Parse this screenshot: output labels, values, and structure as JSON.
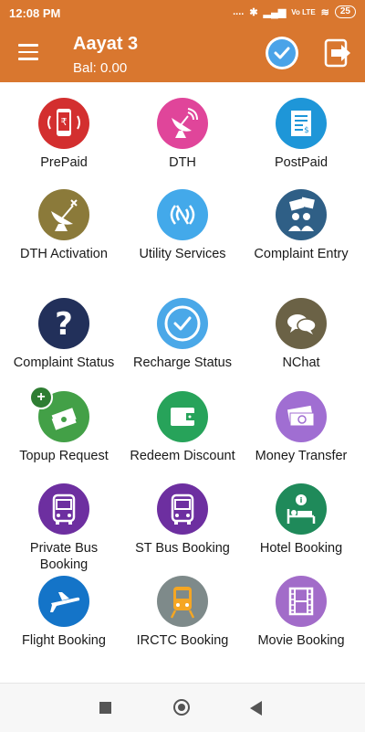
{
  "status_bar": {
    "time": "12:08 PM",
    "signal_text": "....",
    "network": "Vo LTE",
    "battery": "25"
  },
  "header": {
    "title": "Aayat 3",
    "balance": "Bal: 0.00"
  },
  "services": [
    {
      "label": "PrePaid",
      "color": "#d32f2f",
      "icon": "mobile-recharge-icon"
    },
    {
      "label": "DTH",
      "color": "#e0459a",
      "icon": "satellite-dish-icon"
    },
    {
      "label": "PostPaid",
      "color": "#1e96d8",
      "icon": "bill-icon"
    },
    {
      "label": "DTH Activation",
      "color": "#8b7a3a",
      "icon": "dish-antenna-icon"
    },
    {
      "label": "Utility Services",
      "color": "#43a9ea",
      "icon": "wireless-signal-icon"
    },
    {
      "label": "Complaint Entry",
      "color": "#2f5f86",
      "icon": "complaint-icon"
    },
    {
      "label": "Complaint Status",
      "color": "#22305a",
      "icon": "question-icon"
    },
    {
      "label": "Recharge Status",
      "color": "#4aa8e8",
      "icon": "check-icon"
    },
    {
      "label": "NChat",
      "color": "#6b6246",
      "icon": "chat-icon"
    },
    {
      "label": "Topup Request",
      "color": "#43a047",
      "icon": "money-stack-plus-icon"
    },
    {
      "label": "Redeem Discount",
      "color": "#27a35a",
      "icon": "wallet-icon"
    },
    {
      "label": "Money Transfer",
      "color": "#a06ed2",
      "icon": "money-transfer-icon"
    },
    {
      "label": "Private Bus Booking",
      "color": "#6d2fa0",
      "icon": "bus-icon"
    },
    {
      "label": "ST Bus Booking",
      "color": "#6d2fa0",
      "icon": "bus-icon"
    },
    {
      "label": "Hotel Booking",
      "color": "#1f8a5a",
      "icon": "hotel-bed-icon"
    },
    {
      "label": "Flight Booking",
      "color": "#1474c8",
      "icon": "airplane-icon"
    },
    {
      "label": "IRCTC Booking",
      "color": "#7e8a8a",
      "icon": "train-icon"
    },
    {
      "label": "Movie Booking",
      "color": "#a26cc9",
      "icon": "film-icon"
    }
  ]
}
